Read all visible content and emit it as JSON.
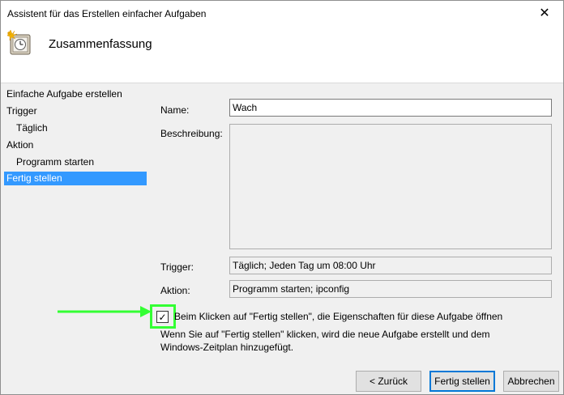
{
  "window": {
    "title": "Assistent für das Erstellen einfacher Aufgaben",
    "close_glyph": "✕"
  },
  "header": {
    "icon": "task-scheduler-clock-icon",
    "title": "Zusammenfassung"
  },
  "sidebar": {
    "items": [
      {
        "label": "Einfache Aufgabe erstellen"
      },
      {
        "label": "Trigger"
      },
      {
        "label": "Täglich"
      },
      {
        "label": "Aktion"
      },
      {
        "label": "Programm starten"
      },
      {
        "label": "Fertig stellen"
      }
    ]
  },
  "form": {
    "name_label": "Name:",
    "name_value": "Wach",
    "description_label": "Beschreibung:",
    "description_value": "",
    "trigger_label": "Trigger:",
    "trigger_value": "Täglich; Jeden Tag um 08:00 Uhr",
    "action_label": "Aktion:",
    "action_value": "Programm starten; ipconfig"
  },
  "options": {
    "open_properties_label": "Beim Klicken auf \"Fertig stellen\", die Eigenschaften für diese Aufgabe öffnen",
    "open_properties_checked": true,
    "check_glyph": "✓",
    "info_text": "Wenn Sie auf \"Fertig stellen\" klicken, wird die neue Aufgabe erstellt und dem Windows-Zeitplan hinzugefügt."
  },
  "annotation": {
    "highlight_color": "#33ff33"
  },
  "buttons": {
    "back_label": "< Zurück",
    "finish_label": "Fertig stellen",
    "cancel_label": "Abbrechen"
  }
}
